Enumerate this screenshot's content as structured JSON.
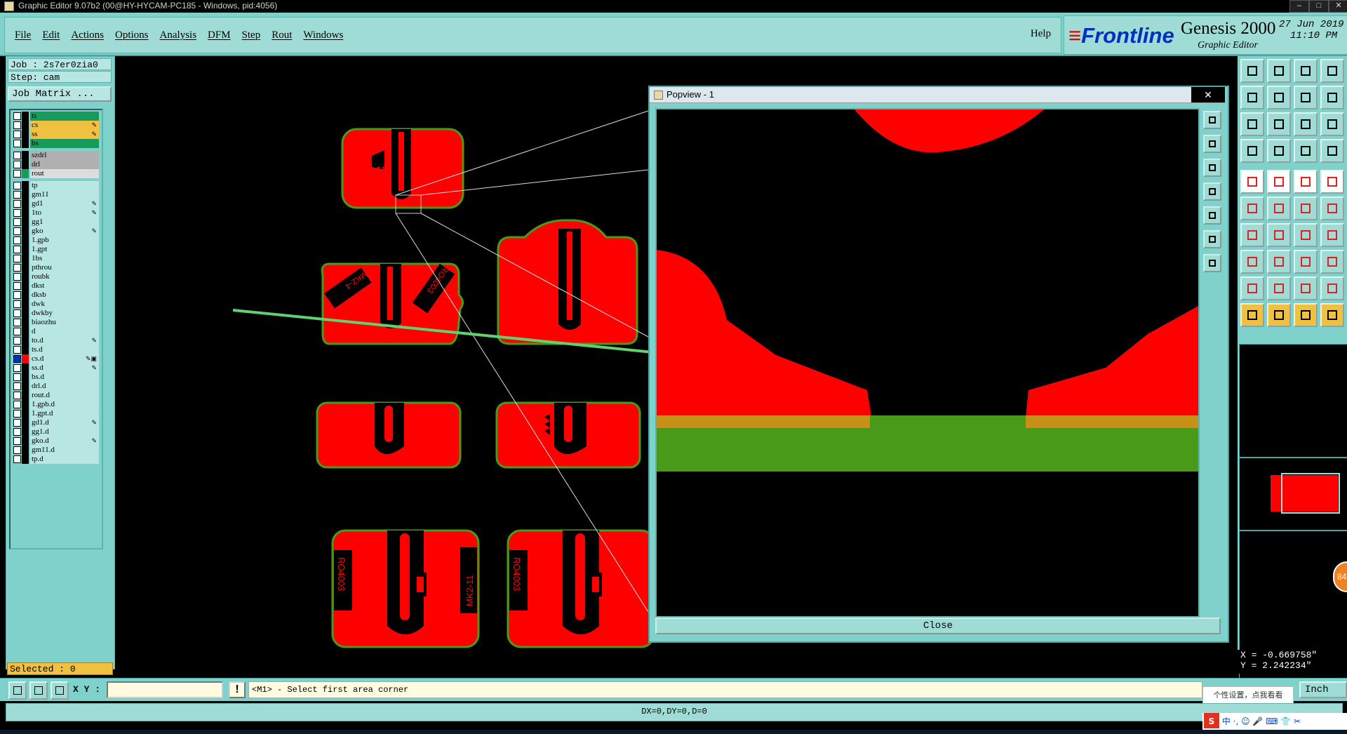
{
  "window": {
    "title": "Graphic Editor 9.07b2 (00@HY-HYCAM-PC185 - Windows, pid:4056)"
  },
  "menu": {
    "items": [
      "File",
      "Edit",
      "Actions",
      "Options",
      "Analysis",
      "DFM",
      "Step",
      "Rout",
      "Windows"
    ],
    "help": "Help"
  },
  "brand": {
    "logo": "Frontline",
    "product": "Genesis 2000",
    "subtitle": "Graphic Editor",
    "date": "27 Jun 2019",
    "time": "11:10 PM"
  },
  "job": {
    "job_label": "Job : 2s7er0zia0",
    "step_label": "Step: cam",
    "matrix_button": "Job Matrix ..."
  },
  "layers": [
    {
      "name": "ts",
      "color": "#1a9a5a",
      "flag": ""
    },
    {
      "name": "cs",
      "color": "#f0c040",
      "flag": "✎"
    },
    {
      "name": "ss",
      "color": "#f0c040",
      "flag": "✎"
    },
    {
      "name": "bs",
      "color": "#1a9a5a",
      "flag": ""
    },
    {
      "name": "szdrl",
      "color": "#b0b0b0",
      "flag": ""
    },
    {
      "name": "drl",
      "color": "#b0b0b0",
      "flag": ""
    },
    {
      "name": "rout",
      "color": "#dcdcdc",
      "flag": ""
    },
    {
      "name": "tp",
      "color": "",
      "flag": ""
    },
    {
      "name": "gm11",
      "color": "",
      "flag": ""
    },
    {
      "name": "gd1",
      "color": "",
      "flag": "✎"
    },
    {
      "name": "1to",
      "color": "",
      "flag": "✎"
    },
    {
      "name": "gg1",
      "color": "",
      "flag": ""
    },
    {
      "name": "gko",
      "color": "",
      "flag": "✎"
    },
    {
      "name": "1.gpb",
      "color": "",
      "flag": ""
    },
    {
      "name": "1.gpt",
      "color": "",
      "flag": ""
    },
    {
      "name": "1bs",
      "color": "",
      "flag": ""
    },
    {
      "name": "pthrou",
      "color": "",
      "flag": ""
    },
    {
      "name": "roubk",
      "color": "",
      "flag": ""
    },
    {
      "name": "dkst",
      "color": "",
      "flag": ""
    },
    {
      "name": "dksb",
      "color": "",
      "flag": ""
    },
    {
      "name": "dwk",
      "color": "",
      "flag": ""
    },
    {
      "name": "dwkby",
      "color": "",
      "flag": ""
    },
    {
      "name": "biaozhu",
      "color": "",
      "flag": ""
    },
    {
      "name": "d",
      "color": "",
      "flag": ""
    },
    {
      "name": "to.d",
      "color": "",
      "flag": "✎"
    },
    {
      "name": "ts.d",
      "color": "",
      "flag": ""
    },
    {
      "name": "cs.d",
      "color": "",
      "flag": "✎▣"
    },
    {
      "name": "ss.d",
      "color": "",
      "flag": "✎"
    },
    {
      "name": "bs.d",
      "color": "",
      "flag": ""
    },
    {
      "name": "drl.d",
      "color": "",
      "flag": ""
    },
    {
      "name": "rout.d",
      "color": "",
      "flag": ""
    },
    {
      "name": "1.gpb.d",
      "color": "",
      "flag": ""
    },
    {
      "name": "1.gpt.d",
      "color": "",
      "flag": ""
    },
    {
      "name": "gd1.d",
      "color": "",
      "flag": "✎"
    },
    {
      "name": "gg1.d",
      "color": "",
      "flag": ""
    },
    {
      "name": "gko.d",
      "color": "",
      "flag": "✎"
    },
    {
      "name": "gm11.d",
      "color": "",
      "flag": ""
    },
    {
      "name": "tp.d",
      "color": "",
      "flag": ""
    }
  ],
  "selected": "Selected : 0",
  "popview": {
    "title": "Popview - 1",
    "close_button": "Close",
    "close_icon": "✕"
  },
  "board": {
    "labels": [
      "18",
      "MK2-4",
      "RO4003",
      "RO4003",
      "MK2-11",
      "RO4003",
      "MK2-11"
    ]
  },
  "coords": {
    "x": "X = -0.669758\"",
    "y": "Y =  2.242234\""
  },
  "bottom": {
    "xy_label": "X Y :",
    "excl": "!",
    "prompt": "<M1> - Select first area corner",
    "unit": "Inch",
    "status": "DX=0,DY=0,D=0"
  },
  "ime": {
    "hint": "个性设置，点我看看",
    "tray": "中 ·, ☺ 🎤 ⌨ 👕 ✂"
  },
  "badge": "84",
  "colors": {
    "teal": "#7fd1cc",
    "copper": "#ff0000",
    "board_outline": "#4a9a1a"
  }
}
